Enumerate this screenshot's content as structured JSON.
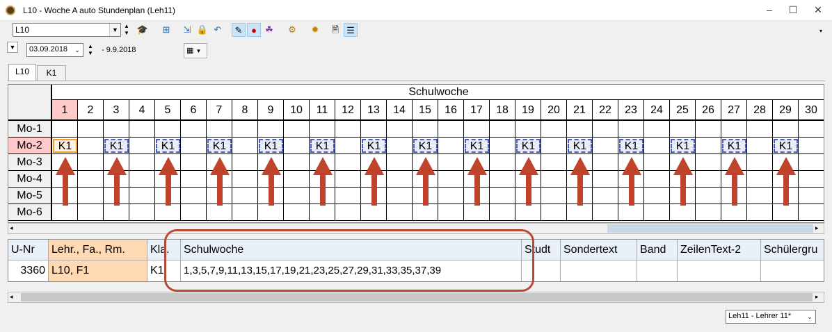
{
  "window": {
    "title": "L10 - Woche A auto  Stundenplan  (Leh11)",
    "minimize": "–",
    "maximize": "☐",
    "close": "✕"
  },
  "toolbar": {
    "element_select": "L10",
    "icons": [
      "graduation-cap-icon",
      "table-icon",
      "import-icon",
      "lock-icon",
      "undo-icon",
      "pencil-icon",
      "pin-icon",
      "users-icon",
      "gear-icon",
      "gear2-icon",
      "document-icon",
      "list-icon"
    ]
  },
  "daterow": {
    "date": "03.09.2018",
    "date_end": "- 9.9.2018"
  },
  "tabs": [
    "L10",
    "K1"
  ],
  "grid": {
    "header_title": "Schulwoche",
    "weeks": [
      "1",
      "2",
      "3",
      "4",
      "5",
      "6",
      "7",
      "8",
      "9",
      "10",
      "11",
      "12",
      "13",
      "14",
      "15",
      "16",
      "17",
      "18",
      "19",
      "20",
      "21",
      "22",
      "23",
      "24",
      "25",
      "26",
      "27",
      "28",
      "29",
      "30"
    ],
    "selected_week": "1",
    "rows": [
      "Mo-1",
      "Mo-2",
      "Mo-3",
      "Mo-4",
      "Mo-5",
      "Mo-6"
    ],
    "selected_row": "Mo-2",
    "lesson_label": "K1",
    "lesson_weeks": [
      1,
      3,
      5,
      7,
      9,
      11,
      13,
      15,
      17,
      19,
      21,
      23,
      25,
      27,
      29
    ],
    "arrow_color": "#c0442b"
  },
  "lower_table": {
    "headers": [
      "U-Nr",
      "Lehr., Fa., Rm.",
      "Kla.",
      "Schulwoche",
      "Studt",
      "Sondertext",
      "Band",
      "ZeilenText-2",
      "Schülergru"
    ],
    "row": [
      "3360",
      "L10, F1",
      "K1",
      "1,3,5,7,9,11,13,15,17,19,21,23,25,27,29,31,33,35,37,39",
      "",
      "",
      "",
      "",
      ""
    ]
  },
  "status": {
    "teacher_select": "Leh11 - Lehrer 11*"
  }
}
